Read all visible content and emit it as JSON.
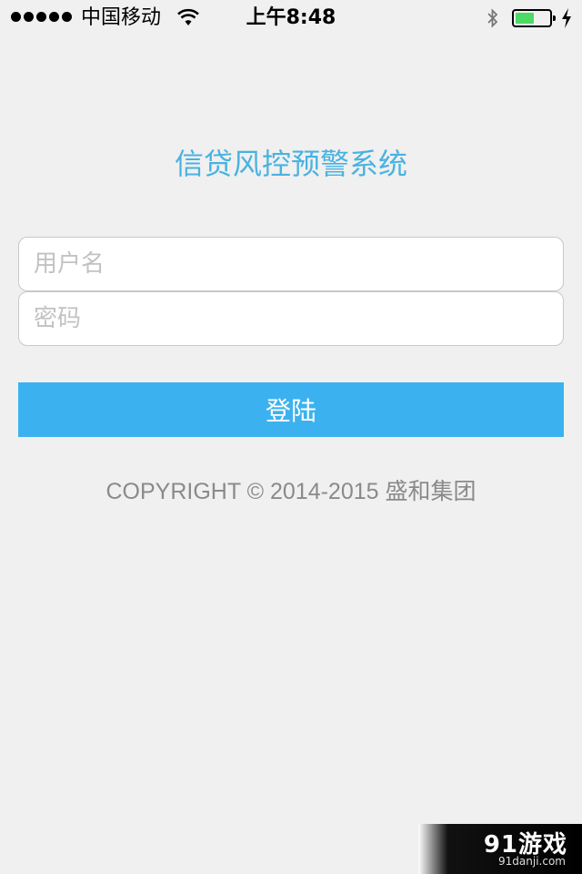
{
  "status_bar": {
    "carrier": "中国移动",
    "time": "上午8:48",
    "battery_fill_fraction": 0.55,
    "battery_color": "#4cd964"
  },
  "login": {
    "title": "信贷风控预警系统",
    "username_placeholder": "用户名",
    "password_placeholder": "密码",
    "username_value": "",
    "password_value": "",
    "submit_label": "登陆"
  },
  "footer": {
    "copyright": "COPYRIGHT © 2014-2015 盛和集团"
  },
  "watermark": {
    "main": "91游戏",
    "sub": "91danji.com"
  },
  "colors": {
    "accent": "#3bb2ef",
    "title": "#4ab2e0",
    "background": "#f0f0f0",
    "muted_text": "#8a8a8a"
  },
  "icons": [
    "signal-dots-icon",
    "wifi-icon",
    "bluetooth-icon",
    "battery-icon",
    "charging-bolt-icon"
  ]
}
